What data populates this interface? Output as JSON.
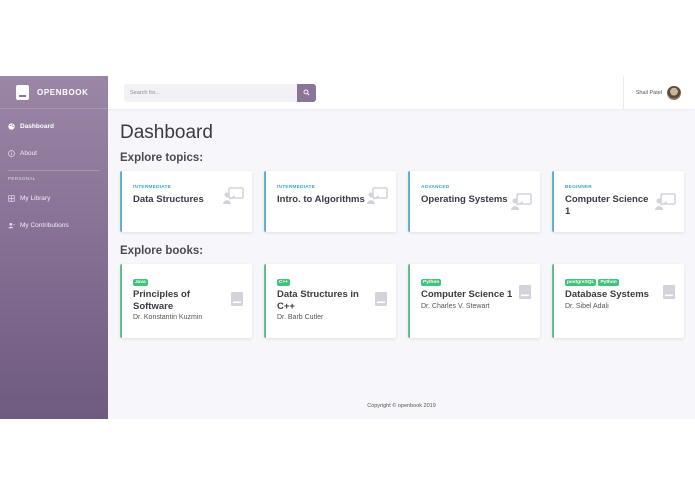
{
  "brand": {
    "name": "OPENBOOK"
  },
  "sidebar": {
    "items": [
      {
        "label": "Dashboard",
        "icon": "palette-icon"
      },
      {
        "label": "About",
        "icon": "info-icon"
      }
    ],
    "personal_heading": "PERSONAL",
    "personal_items": [
      {
        "label": "My Library",
        "icon": "grid-icon"
      },
      {
        "label": "My Contributions",
        "icon": "user-icon"
      }
    ]
  },
  "header": {
    "search_placeholder": "Search for...",
    "user_name": "Shail Patel"
  },
  "main": {
    "title": "Dashboard",
    "topics_heading": "Explore topics:",
    "topics": [
      {
        "level": "INTERMEDIATE",
        "title": "Data Structures"
      },
      {
        "level": "INTERMEDIATE",
        "title": "Intro. to Algorithms"
      },
      {
        "level": "ADVANCED",
        "title": "Operating Systems"
      },
      {
        "level": "BEGINNER",
        "title": "Computer Science 1"
      }
    ],
    "books_heading": "Explore books:",
    "books": [
      {
        "tags": [
          "Java"
        ],
        "title": "Principles of Software",
        "author": "Dr. Konstantin Kuzmin"
      },
      {
        "tags": [
          "C++"
        ],
        "title": "Data Structures in C++",
        "author": "Dr. Barb Cutler"
      },
      {
        "tags": [
          "Python"
        ],
        "title": "Computer Science 1",
        "author": "Dr. Charles V. Stewart"
      },
      {
        "tags": [
          "postgreSQL",
          "Python"
        ],
        "title": "Database Systems",
        "author": "Dr. Sibel Adalı"
      }
    ]
  },
  "footer": {
    "text": "Copyright © openbook 2019"
  },
  "colors": {
    "sidebar_top": "#9b86a6",
    "sidebar_bottom": "#6f5a80",
    "topic_accent": "#5bb6c9",
    "book_accent": "#5cc48a",
    "search_button": "#8a7498"
  }
}
